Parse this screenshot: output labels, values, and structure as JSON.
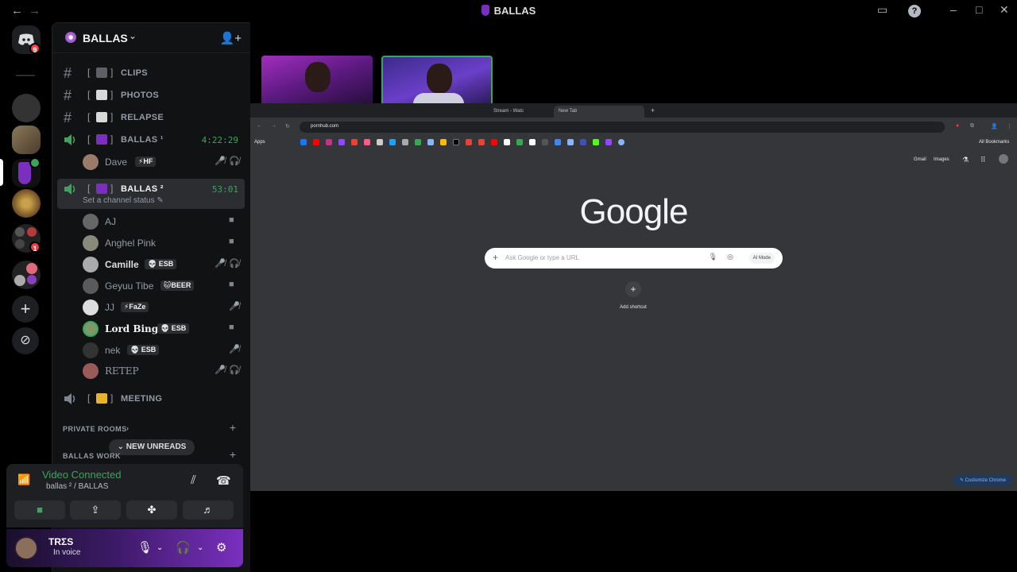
{
  "window": {
    "title": "BALLAS"
  },
  "rail": {
    "discord_badge": "9",
    "server_badge": "1"
  },
  "guild": {
    "name": "BALLAS"
  },
  "channels": [
    {
      "bracket": "[",
      "bracket_close": "]",
      "name": "CLIPS"
    },
    {
      "bracket": "[",
      "bracket_close": "]",
      "name": "PHOTOS"
    },
    {
      "bracket": "[",
      "bracket_close": "]",
      "name": "RELAPSE"
    },
    {
      "bracket": "[",
      "bracket_close": "]",
      "name": "BALLAS ¹",
      "timer": "4:22:29"
    },
    {
      "bracket": "[",
      "bracket_close": "]",
      "name": "BALLAS ²",
      "timer": "53:01",
      "status": "Set a channel status ✎"
    },
    {
      "bracket": "[",
      "bracket_close": "]",
      "name": "MEETING"
    }
  ],
  "voice_users_1": [
    {
      "name": "Dave",
      "tag": "⚡HF"
    }
  ],
  "voice_users_2": [
    {
      "name": "AJ",
      "tag": ""
    },
    {
      "name": "Anghel Pink",
      "tag": ""
    },
    {
      "name": "Camille",
      "tag": "💀 ESB"
    },
    {
      "name": "Geyuu Tibe",
      "tag": "🐱BEER"
    },
    {
      "name": "JJ",
      "tag": "⚡FaZe"
    },
    {
      "name": "Lord Bing",
      "tag": "💀 ESB"
    },
    {
      "name": "nek",
      "tag": "💀 ESB"
    },
    {
      "name": "RETEP",
      "tag": ""
    }
  ],
  "categories": {
    "private_rooms": "PRIVATE ROOMS",
    "ballas_work": "BALLAS WORK"
  },
  "new_unreads": "NEW UNREADS",
  "voice_panel": {
    "title": "Video Connected",
    "subtitle": "ballas ² / BALLAS"
  },
  "user_panel": {
    "name": "TRΣS",
    "status": "In voice"
  },
  "browser": {
    "tabs": [
      "Stream - Watc",
      "New Tab"
    ],
    "url": "pornhub.com",
    "apps_label": "Apps",
    "all_bookmarks": "All Bookmarks",
    "gmail": "Gmail",
    "images": "Images",
    "logo": "Google",
    "search_placeholder": "Ask Google or type a URL",
    "ai_mode": "AI Mode",
    "add_shortcut": "Add shortcut",
    "customize": "Customize Chrome"
  },
  "colors": {
    "accent_green": "#3ba55d",
    "brand_purple": "#7a2fbf",
    "badge_red": "#f23f43"
  },
  "icons": [
    "back-arrow-icon",
    "forward-arrow-icon",
    "discord-icon",
    "add-server-icon",
    "discover-icon",
    "hashtag-icon",
    "speaker-icon",
    "video-icon",
    "mute-icon",
    "deafen-icon",
    "settings-icon",
    "headphones-icon",
    "microphone-icon",
    "signal-icon",
    "hangup-icon"
  ]
}
